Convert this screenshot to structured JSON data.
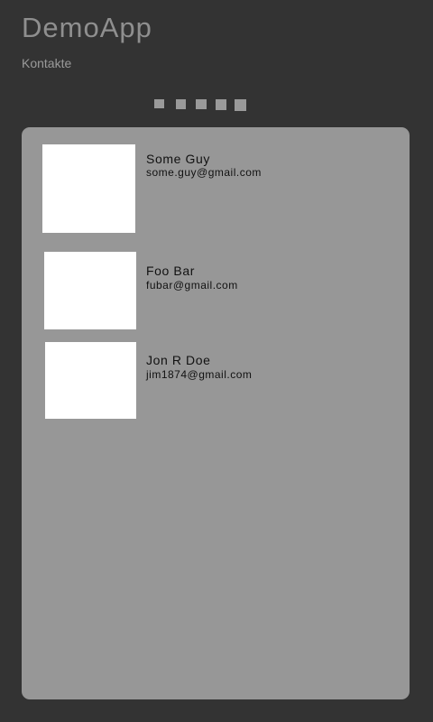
{
  "app": {
    "title": "DemoApp",
    "section": "Kontakte"
  },
  "pager": {
    "page_count": 5,
    "active_page": 5
  },
  "contacts": [
    {
      "name": "Some Guy",
      "email": "some.guy@gmail.com"
    },
    {
      "name": "Foo Bar",
      "email": "fubar@gmail.com"
    },
    {
      "name": "Jon R Doe",
      "email": "jim1874@gmail.com"
    }
  ],
  "colors": {
    "background": "#333333",
    "panel": "#979797",
    "avatar": "#ffffff",
    "title_text": "#8f8f8f",
    "contact_text": "#111111"
  }
}
